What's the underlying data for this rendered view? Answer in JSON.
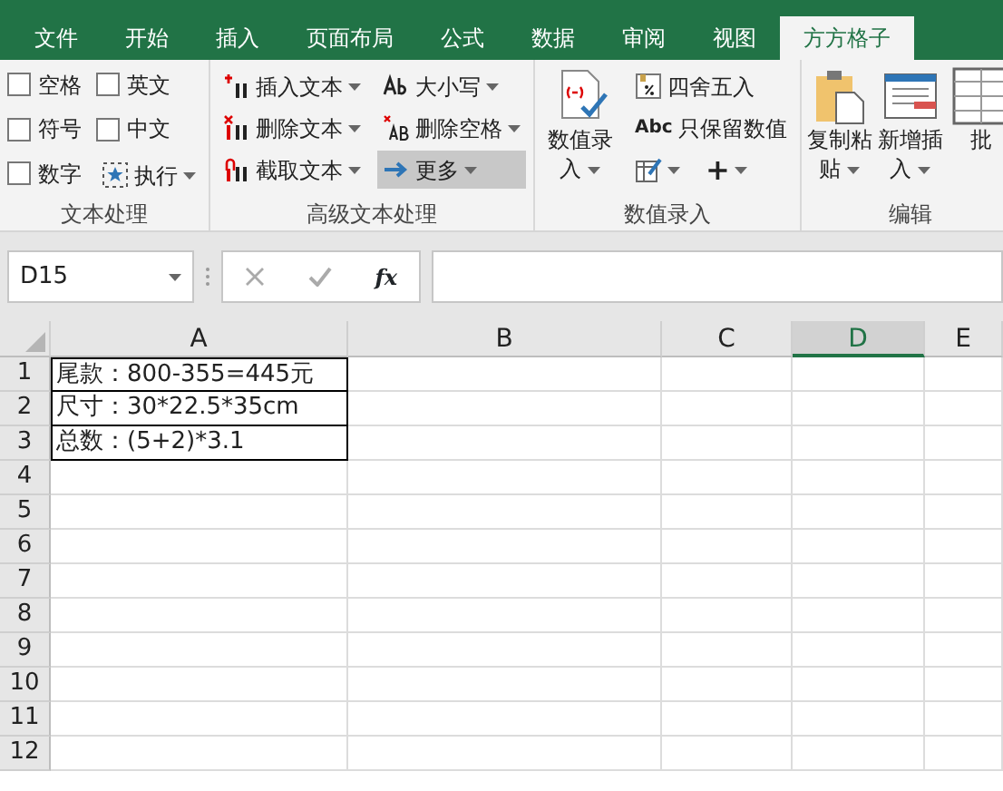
{
  "ribbon_tabs": [
    {
      "label": "文件",
      "selected": false
    },
    {
      "label": "开始",
      "selected": false
    },
    {
      "label": "插入",
      "selected": false
    },
    {
      "label": "页面布局",
      "selected": false
    },
    {
      "label": "公式",
      "selected": false
    },
    {
      "label": "数据",
      "selected": false
    },
    {
      "label": "审阅",
      "selected": false
    },
    {
      "label": "视图",
      "selected": false
    },
    {
      "label": "方方格子",
      "selected": true
    }
  ],
  "groups": [
    {
      "label": "文本处理",
      "kind": "checks",
      "items": [
        {
          "label": "空格",
          "checked": false
        },
        {
          "label": "英文",
          "checked": false
        },
        {
          "label": "符号",
          "checked": false
        },
        {
          "label": "中文",
          "checked": false
        },
        {
          "label": "数字",
          "checked": false
        },
        {
          "label": "执行",
          "kind": "button",
          "dropdown": true
        }
      ]
    },
    {
      "label": "高级文本处理",
      "kind": "columns",
      "columns": [
        [
          {
            "label": "插入文本",
            "dropdown": true,
            "highlighted": false
          },
          {
            "label": "删除文本",
            "dropdown": true,
            "highlighted": false
          },
          {
            "label": "截取文本",
            "dropdown": true,
            "highlighted": false
          }
        ],
        [
          {
            "label": "大小写",
            "dropdown": true,
            "highlighted": false
          },
          {
            "label": "删除空格",
            "dropdown": true,
            "highlighted": false
          },
          {
            "label": "更多",
            "dropdown": true,
            "highlighted": true
          }
        ]
      ]
    },
    {
      "label": "数值录入",
      "kind": "mixed",
      "big": [
        {
          "label": "数值录入",
          "dropdown": true
        }
      ],
      "small": [
        {
          "label": "四舍五入"
        },
        {
          "label": "只保留数值",
          "prefix": "Abc"
        }
      ],
      "tools": [
        {
          "label": "+"
        }
      ]
    },
    {
      "label": "编辑",
      "kind": "big",
      "big": [
        {
          "label": "复制粘贴",
          "dropdown": true
        },
        {
          "label": "新增插入",
          "dropdown": true
        },
        {
          "label": "批"
        }
      ]
    }
  ],
  "name_box": "D15",
  "formula": {
    "fx": "fx"
  },
  "columns": [
    {
      "label": "A",
      "selected": false
    },
    {
      "label": "B",
      "selected": false
    },
    {
      "label": "C",
      "selected": false
    },
    {
      "label": "D",
      "selected": true
    },
    {
      "label": "E",
      "selected": false
    }
  ],
  "rows": [
    {
      "number": "1",
      "cells": [
        "尾款：800-355=445元"
      ]
    },
    {
      "number": "2",
      "cells": [
        "尺寸：30*22.5*35cm"
      ]
    },
    {
      "number": "3",
      "cells": [
        "总数：(5+2)*3.1"
      ]
    },
    {
      "number": "4",
      "cells": []
    },
    {
      "number": "5",
      "cells": []
    },
    {
      "number": "6",
      "cells": []
    },
    {
      "number": "7",
      "cells": []
    },
    {
      "number": "8",
      "cells": []
    },
    {
      "number": "9",
      "cells": []
    },
    {
      "number": "10",
      "cells": []
    },
    {
      "number": "11",
      "cells": []
    },
    {
      "number": "12",
      "cells": []
    }
  ]
}
